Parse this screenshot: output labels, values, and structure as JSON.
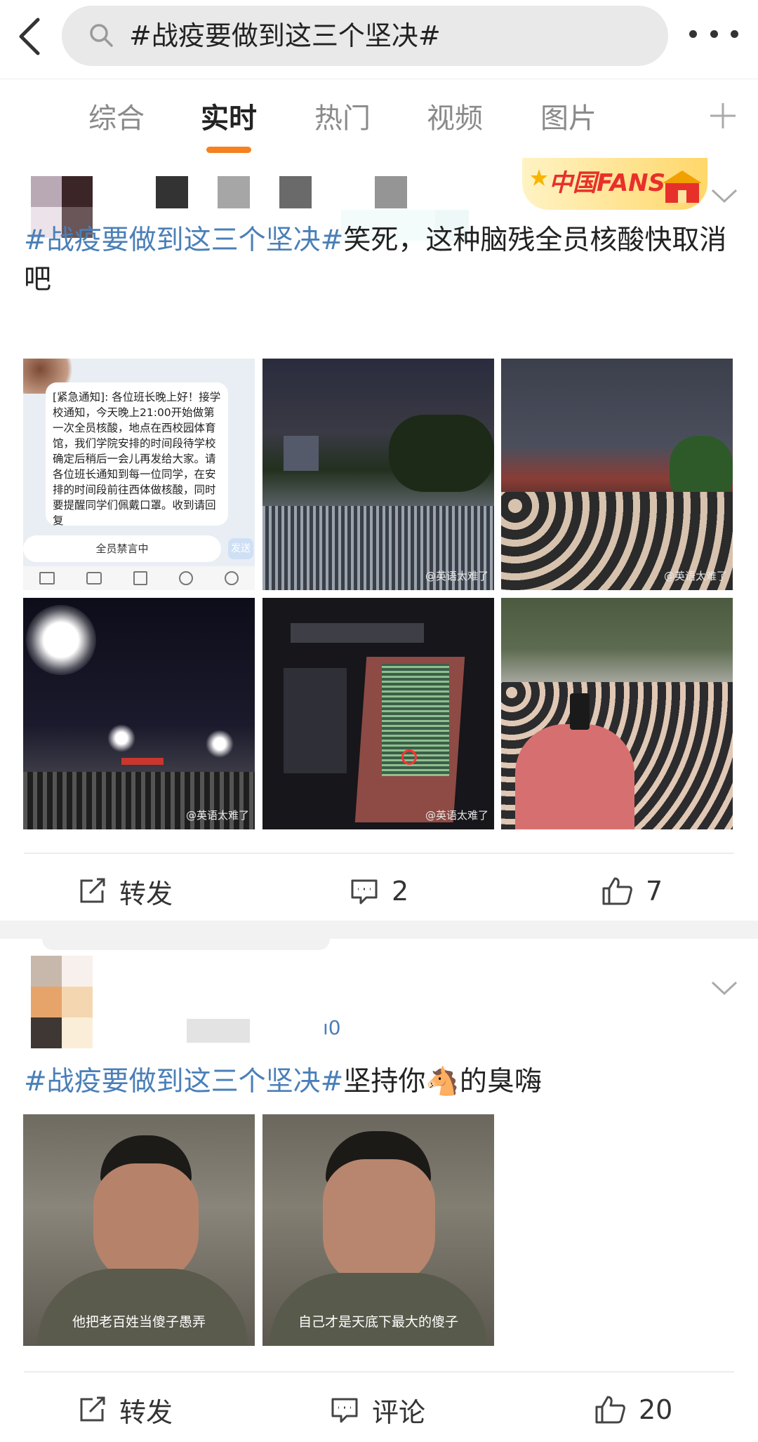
{
  "search": {
    "query": "#战疫要做到这三个坚决#"
  },
  "tabs": [
    {
      "label": "综合"
    },
    {
      "label": "实时"
    },
    {
      "label": "热门"
    },
    {
      "label": "视频"
    },
    {
      "label": "图片"
    }
  ],
  "active_tab": "实时",
  "accent_color": "#f58220",
  "hashtag_color": "#4a7fb8",
  "posts": [
    {
      "hashtag": "#战疫要做到这三个坚决#",
      "text": "笑死，这种脑残全员核酸快取消吧",
      "badge": "中国FANS",
      "notice": {
        "title": "[紧急通知]",
        "body": "各位班长晚上好！接学校通知，今天晚上21:00开始做第一次全员核酸，地点在西校园体育馆，我们学院安排的时间段待学校确定后稍后一会儿再发给大家。请各位班长通知到每一位同学，在安排的时间段前往西体做核酸，同时要提醒同学们佩戴口罩。收到请回复",
        "muted": "全员禁言中",
        "send": "发送"
      },
      "watermark": "@英语太难了",
      "actions": {
        "repost": "转发",
        "comment": "2",
        "like": "7"
      }
    },
    {
      "hashtag": "#战疫要做到这三个坚决#",
      "text": "坚持你🐴的臭嗨",
      "meta_fragment": "ı0",
      "captions": [
        "他把老百姓当傻子愚弄",
        "自己才是天底下最大的傻子"
      ],
      "actions": {
        "repost": "转发",
        "comment": "评论",
        "like": "20"
      }
    }
  ]
}
